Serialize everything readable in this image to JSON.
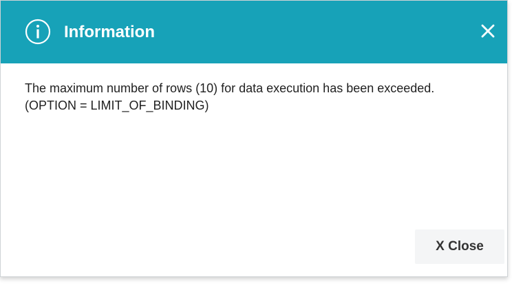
{
  "dialog": {
    "title": "Information",
    "icon": "info-circle-icon",
    "close_icon": "close-icon",
    "message": {
      "line1": "The maximum number of rows (10) for data execution has been exceeded.",
      "line2": "(OPTION = LIMIT_OF_BINDING)"
    },
    "close_button_label": "X Close"
  },
  "colors": {
    "header": "#17a2b8",
    "header_text": "#ffffff",
    "button_bg": "#f4f5f6"
  }
}
